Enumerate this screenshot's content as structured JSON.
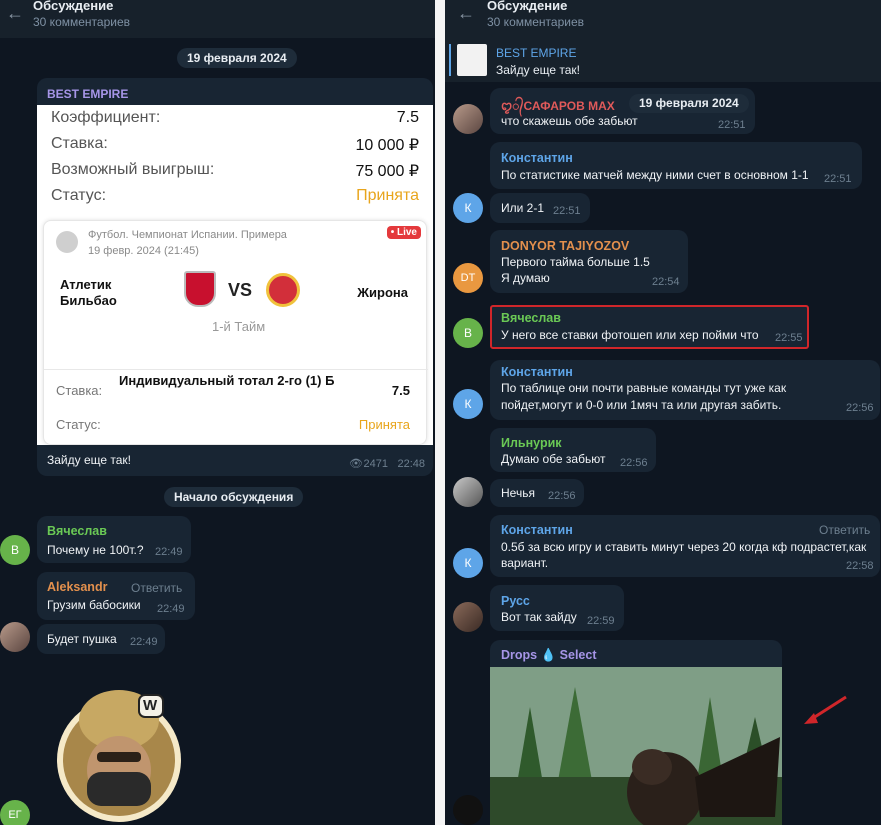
{
  "left": {
    "title": "Обсуждение",
    "subtitle": "30 комментариев",
    "date": "19 февраля 2024",
    "post": {
      "channel": "BEST EMPIRE",
      "rows": [
        {
          "label": "Коэффициент:",
          "value": "7.5"
        },
        {
          "label": "Ставка:",
          "value": "10 000 ₽"
        },
        {
          "label": "Возможный выигрыш:",
          "value": "75 000 ₽"
        },
        {
          "label": "Статус:",
          "value": "Принята"
        }
      ],
      "match": {
        "league": "Футбол. Чемпионат Испании. Примера",
        "date": "19 февр. 2024 (21:45)",
        "live": "• Live",
        "team1": "Атлетик Бильбао",
        "vs": "VS",
        "team2": "Жирона",
        "period": "1-й Тайм"
      },
      "bet_label": "Ставка:",
      "bet_text": "Индивидуальный тотал 2-го (1) Б",
      "bet_value": "7.5",
      "status_label": "Статус:",
      "status_value": "Принята",
      "caption": "Зайду еще так!",
      "views": "2471",
      "time": "22:48"
    },
    "discussion_start": "Начало обсуждения",
    "messages": [
      {
        "avatar": "В",
        "name": "Вячеслав",
        "text": "Почему не 100т.?",
        "time": "22:49"
      },
      {
        "name": "Aleksandr",
        "reply": "Ответить",
        "text": "Грузим бабосики",
        "time": "22:49"
      },
      {
        "text": "Будет пушка",
        "time": "22:49"
      }
    ],
    "sticker_badge": "W",
    "bottom_avatar": "ЕГ"
  },
  "right": {
    "title": "Обсуждение",
    "subtitle": "30 комментариев",
    "pinned": {
      "channel": "BEST EMPIRE",
      "text": "Зайду еще так!"
    },
    "date": "19 февраля 2024",
    "messages": [
      {
        "name": "ꨄ᭄САФАРОВ MAX",
        "text": "что скажешь обе забьют",
        "time": "22:51"
      },
      {
        "name": "Константин",
        "text": "По статистике матчей между ними счет в основном 1-1",
        "time": "22:51"
      },
      {
        "avatar": "К",
        "text": "Или 2-1",
        "time": "22:51"
      },
      {
        "avatar": "DT",
        "name": "DONYOR TAJIYOZOV",
        "text": "Первого тайма больше 1.5",
        "text2": "Я думаю",
        "time": "22:54"
      },
      {
        "avatar": "В",
        "name": "Вячеслав",
        "text": "У него все ставки фотошеп или хер пойми что",
        "time": "22:55"
      },
      {
        "avatar": "К",
        "name": "Константин",
        "text": "По таблице они почти равные команды тут уже как",
        "text2": "пойдет,могут и 0-0 или 1мяч та или другая забить.",
        "time": "22:56"
      },
      {
        "name": "Ильнурик",
        "text": "Думаю обе забьют",
        "time": "22:56"
      },
      {
        "text": "Нечья",
        "time": "22:56"
      },
      {
        "avatar": "К",
        "name": "Константин",
        "reply": "Ответить",
        "text": "0.5б за всю игру и ставить минут через 20 когда кф подрастет,как",
        "text2": "вариант.",
        "time": "22:58"
      },
      {
        "name": "Русс",
        "text": "Вот так зайду",
        "time": "22:59"
      },
      {
        "name": "Drops",
        "name_icon": "💧",
        "name2": "Select"
      }
    ]
  },
  "colors": {
    "bg": "#0e1621",
    "bubble": "#182533",
    "accent": "#5ea5e8",
    "status": "#e8a51c",
    "highlight": "#d0262a"
  }
}
